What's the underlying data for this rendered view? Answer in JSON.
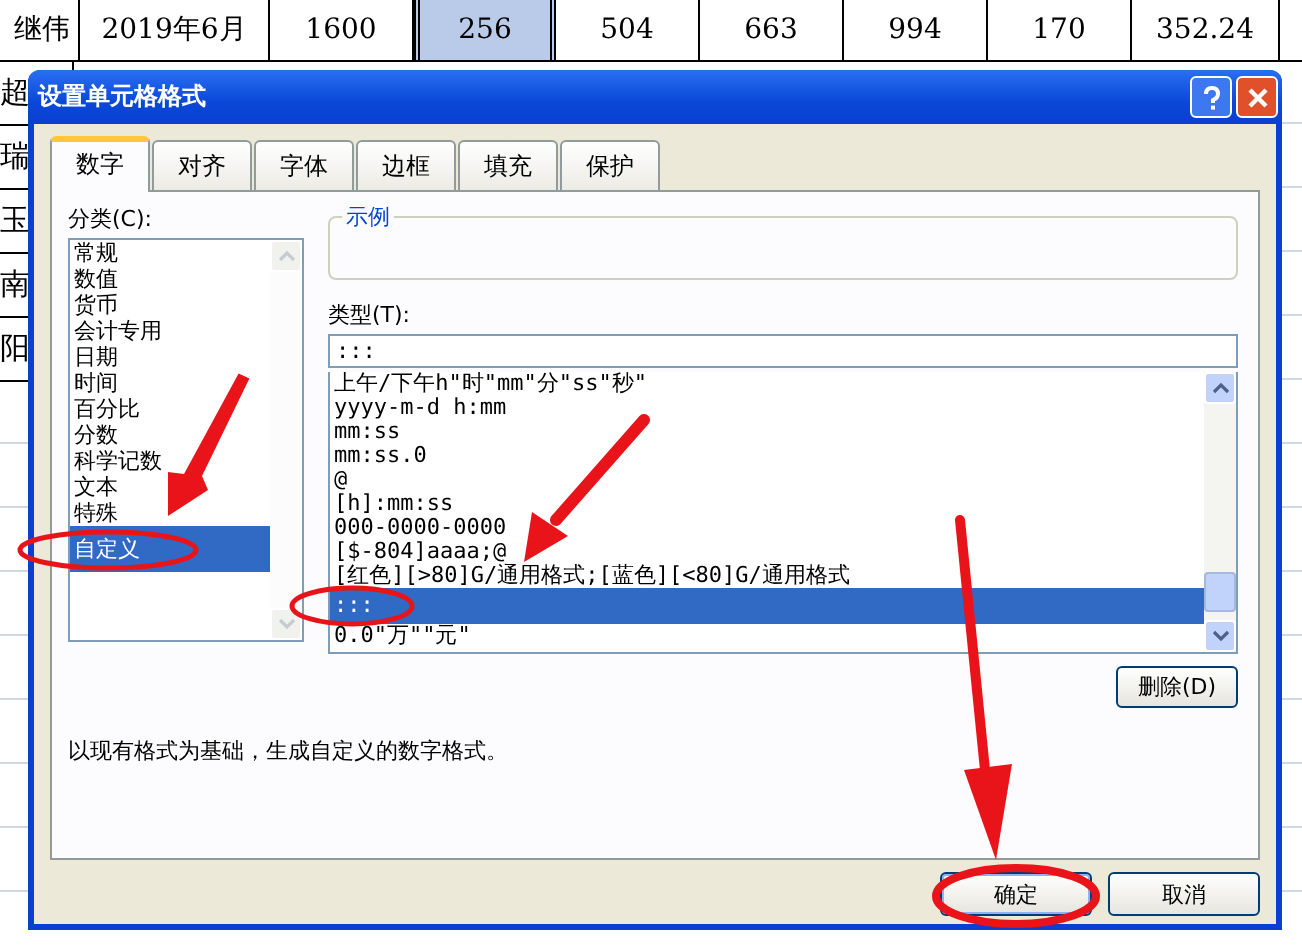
{
  "sheet": {
    "top_row": [
      {
        "text": "继伟",
        "selected": false
      },
      {
        "text": "2019年6月",
        "selected": false
      },
      {
        "text": "1600",
        "selected": false
      },
      {
        "text": "256",
        "selected": true
      },
      {
        "text": "504",
        "selected": false
      },
      {
        "text": "663",
        "selected": false
      },
      {
        "text": "994",
        "selected": false
      },
      {
        "text": "170",
        "selected": false
      },
      {
        "text": "352.24",
        "selected": false
      }
    ],
    "name_cells": [
      "超",
      "瑞",
      "玉",
      "南",
      "阳"
    ]
  },
  "dialog": {
    "title": "设置单元格格式",
    "tabs": [
      {
        "label": "数字",
        "selected": true
      },
      {
        "label": "对齐",
        "selected": false
      },
      {
        "label": "字体",
        "selected": false
      },
      {
        "label": "边框",
        "selected": false
      },
      {
        "label": "填充",
        "selected": false
      },
      {
        "label": "保护",
        "selected": false
      }
    ],
    "category": {
      "label": "分类(C):",
      "items": [
        {
          "text": "常规",
          "selected": false
        },
        {
          "text": "数值",
          "selected": false
        },
        {
          "text": "货币",
          "selected": false
        },
        {
          "text": "会计专用",
          "selected": false
        },
        {
          "text": "日期",
          "selected": false
        },
        {
          "text": "时间",
          "selected": false
        },
        {
          "text": "百分比",
          "selected": false
        },
        {
          "text": "分数",
          "selected": false
        },
        {
          "text": "科学记数",
          "selected": false
        },
        {
          "text": "文本",
          "selected": false
        },
        {
          "text": "特殊",
          "selected": false
        },
        {
          "text": "自定义",
          "selected": true
        }
      ]
    },
    "sample": {
      "label": "示例"
    },
    "type": {
      "label": "类型(T):",
      "value": ":::",
      "items": [
        {
          "text": "上午/下午h\"时\"mm\"分\"ss\"秒\"",
          "selected": false
        },
        {
          "text": "yyyy-m-d h:mm",
          "selected": false
        },
        {
          "text": "mm:ss",
          "selected": false
        },
        {
          "text": "mm:ss.0",
          "selected": false
        },
        {
          "text": "@",
          "selected": false
        },
        {
          "text": "[h]:mm:ss",
          "selected": false
        },
        {
          "text": "000-0000-0000",
          "selected": false
        },
        {
          "text": "[$-804]aaaa;@",
          "selected": false
        },
        {
          "text": "[红色][>80]G/通用格式;[蓝色][<80]G/通用格式",
          "selected": false
        },
        {
          "text": ":::",
          "selected": true
        },
        {
          "text": "0.0\"万\"\"元\"",
          "selected": false
        }
      ]
    },
    "delete_button": "删除(D)",
    "description": "以现有格式为基础，生成自定义的数字格式。",
    "buttons": [
      {
        "label": "确定",
        "default": true
      },
      {
        "label": "取消",
        "default": false
      }
    ]
  }
}
